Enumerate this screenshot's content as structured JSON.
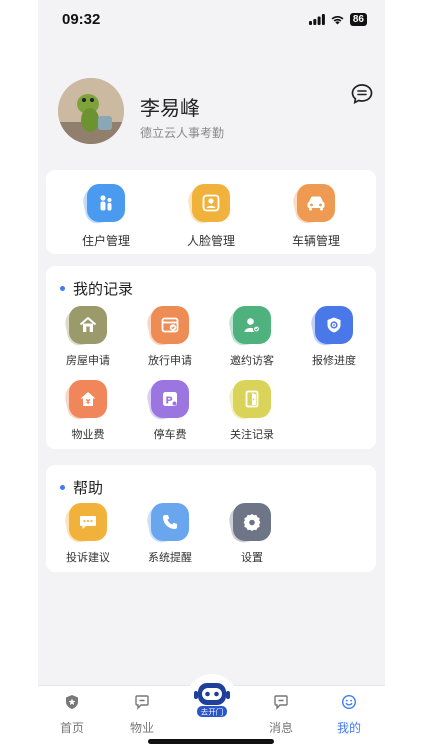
{
  "status_bar": {
    "time": "09:32",
    "battery": "86"
  },
  "profile": {
    "name": "李易峰",
    "org": "德立云人事考勤"
  },
  "top_actions": [
    {
      "label": "住户管理",
      "icon": "household-icon",
      "color": "#4a9af0"
    },
    {
      "label": "人脸管理",
      "icon": "face-id-icon",
      "color": "#f2b23c"
    },
    {
      "label": "车辆管理",
      "icon": "car-icon",
      "color": "#ef9a52"
    }
  ],
  "records": {
    "title": "我的记录",
    "items": [
      {
        "label": "房屋申请",
        "icon": "house-icon",
        "color": "#9b9a6a"
      },
      {
        "label": "放行申请",
        "icon": "release-card-icon",
        "color": "#ee8c55"
      },
      {
        "label": "邀约访客",
        "icon": "visitor-icon",
        "color": "#4fb37e"
      },
      {
        "label": "报修进度",
        "icon": "repair-shield-icon",
        "color": "#4b78e8"
      },
      {
        "label": "物业费",
        "icon": "property-fee-icon",
        "color": "#f0865a"
      },
      {
        "label": "停车费",
        "icon": "parking-fee-icon",
        "color": "#9b76e0"
      },
      {
        "label": "关注记录",
        "icon": "follow-door-icon",
        "color": "#d9d45a"
      }
    ]
  },
  "help": {
    "title": "帮助",
    "items": [
      {
        "label": "投诉建议",
        "icon": "chat-bubble-icon",
        "color": "#f2b23c"
      },
      {
        "label": "系统提醒",
        "icon": "phone-icon",
        "color": "#6aa6ef"
      },
      {
        "label": "设置",
        "icon": "gear-icon",
        "color": "#6d7588"
      }
    ]
  },
  "tabbar": {
    "tabs": [
      {
        "label": "首页",
        "icon": "shield-home-icon"
      },
      {
        "label": "物业",
        "icon": "property-bubble-icon"
      },
      {
        "label": "消息",
        "icon": "message-bubble-icon"
      },
      {
        "label": "我的",
        "icon": "smile-icon",
        "active": true
      }
    ],
    "center_badge": "去开门",
    "accent": "#3e7bf7"
  }
}
